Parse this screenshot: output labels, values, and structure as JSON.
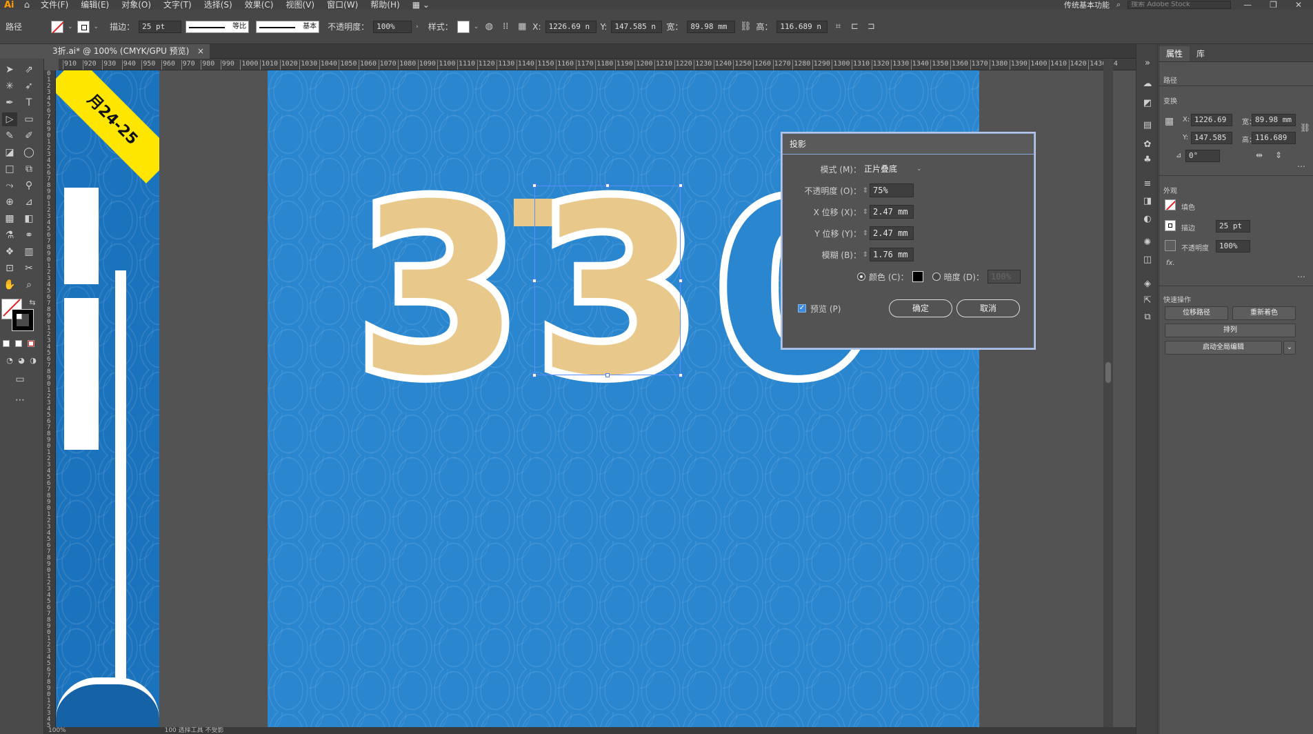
{
  "app": {
    "logo": "Ai"
  },
  "menu": {
    "items": [
      "文件(F)",
      "编辑(E)",
      "对象(O)",
      "文字(T)",
      "选择(S)",
      "效果(C)",
      "视图(V)",
      "窗口(W)",
      "帮助(H)"
    ],
    "workspace": "传统基本功能",
    "search_placeholder": "搜索 Adobe Stock"
  },
  "control": {
    "selection_label": "路径",
    "stroke_label": "描边：",
    "stroke_value": "25 pt",
    "profile_label": "等比",
    "brush_label": "基本",
    "opacity_label": "不透明度：",
    "opacity_value": "100%",
    "style_label": "样式：",
    "x_label": "X:",
    "x_value": "1226.69 n",
    "y_label": "Y:",
    "y_value": "147.585 n",
    "w_label": "宽：",
    "w_value": "89.98 mm",
    "h_label": "高：",
    "h_value": "116.689 n"
  },
  "document": {
    "tab_title": "3折.ai* @ 100% (CMYK/GPU 预览)",
    "close": "×"
  },
  "ruler": {
    "h_ticks": [
      "910",
      "920",
      "930",
      "940",
      "950",
      "960",
      "970",
      "980",
      "990",
      "1000",
      "1010",
      "1020",
      "1030",
      "1040",
      "1050",
      "1060",
      "1070",
      "1080",
      "1090",
      "1100",
      "1110",
      "1120",
      "1130",
      "1140",
      "1150",
      "1160",
      "1170",
      "1180",
      "1190",
      "1200",
      "1210",
      "1220",
      "1230",
      "1240",
      "1250",
      "1260",
      "1270",
      "1280",
      "1290",
      "1300",
      "1310",
      "1320",
      "1330",
      "1340",
      "1350",
      "1360",
      "1370",
      "1380",
      "1390",
      "1400",
      "1410",
      "1420",
      "1430",
      "14"
    ]
  },
  "artwork": {
    "ribbon_text": "月24-25",
    "digits": [
      "3",
      "3",
      "0"
    ],
    "colors": {
      "bg": "#2a86cf",
      "ribbon": "#ffe600",
      "digit_fill": "#e8c98b",
      "selection": "#5c8dff"
    }
  },
  "dialog": {
    "title": "投影",
    "mode_label": "模式 (M)：",
    "mode_value": "正片叠底",
    "opacity_label": "不透明度 (O)：",
    "opacity_value": "75%",
    "x_label": "X 位移 (X)：",
    "x_value": "2.47 mm",
    "y_label": "Y 位移 (Y)：",
    "y_value": "2.47 mm",
    "blur_label": "模糊 (B)：",
    "blur_value": "1.76 mm",
    "color_label": "颜色 (C)：",
    "darkness_label": "暗度 (D)：",
    "darkness_value": "100%",
    "preview_label": "预览 (P)",
    "ok_label": "确定",
    "cancel_label": "取消"
  },
  "properties": {
    "tab_properties": "属性",
    "tab_library": "库",
    "kind": "路径",
    "transform_title": "变换",
    "x_label": "X:",
    "x_value": "1226.69",
    "y_label": "Y:",
    "y_value": "147.585",
    "w_label": "宽：",
    "w_value": "89.98 mm",
    "h_label": "高：",
    "h_value": "116.689",
    "angle_value": "0°",
    "appearance_title": "外观",
    "fill_label": "填色",
    "stroke_label": "描边",
    "stroke_value": "25 pt",
    "opacity_label": "不透明度",
    "opacity_value": "100%",
    "fx_label": "fx.",
    "quick_actions_title": "快速操作",
    "offset_path": "位移路径",
    "recolor": "重新着色",
    "arrange": "排列",
    "global_edit": "启动全局编辑"
  },
  "status": {
    "zoom": "100%",
    "text": "100   选择工具   不受影"
  }
}
